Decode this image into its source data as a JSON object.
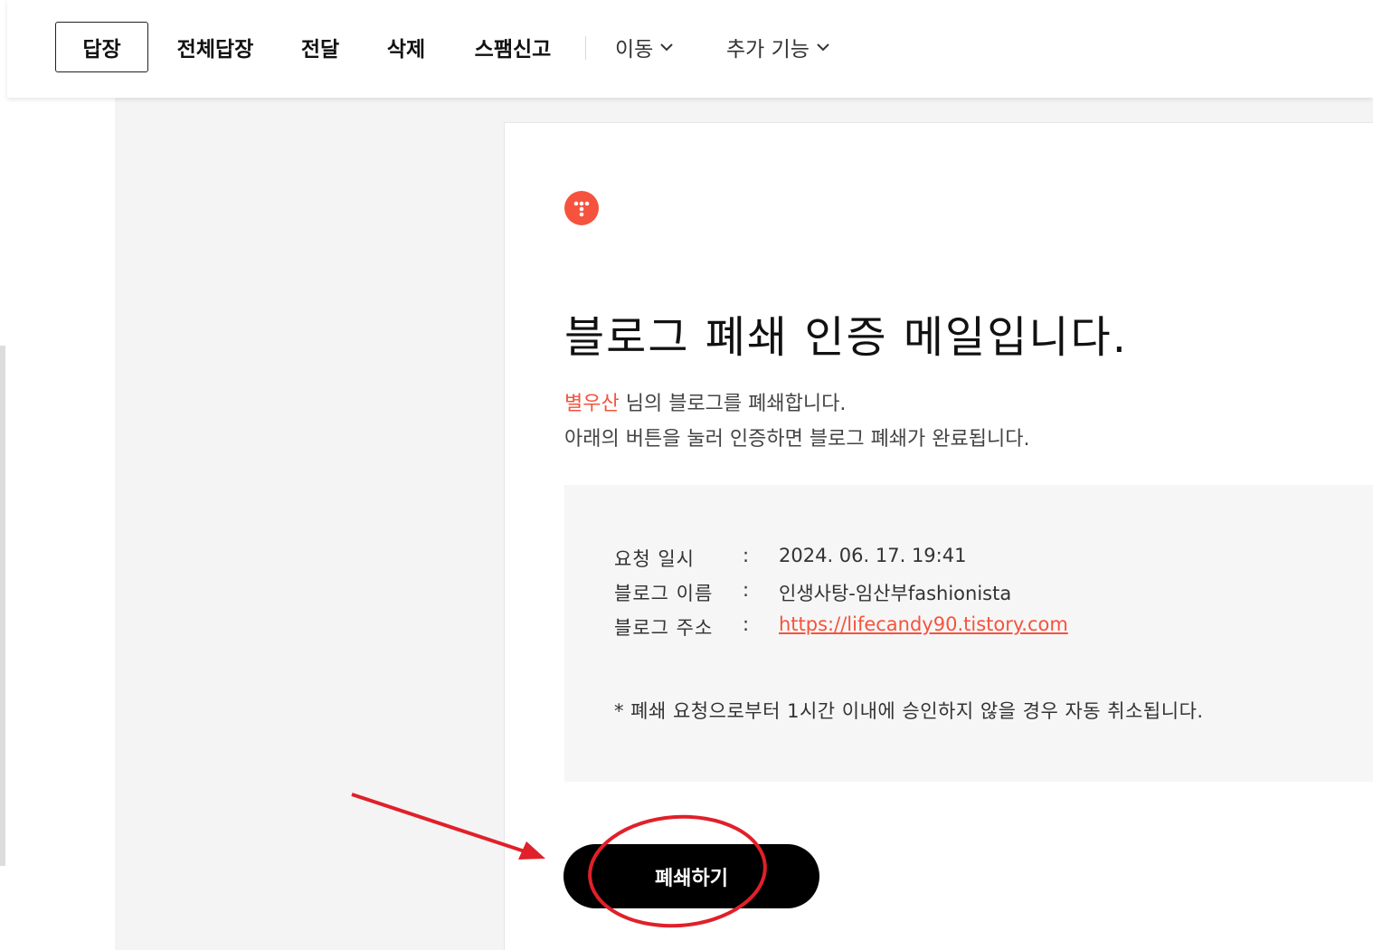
{
  "toolbar": {
    "reply": "답장",
    "reply_all": "전체답장",
    "forward": "전달",
    "delete": "삭제",
    "spam": "스팸신고",
    "move": "이동",
    "more": "추가 기능",
    "chevron_icon": "chevron-down-icon"
  },
  "mail": {
    "logo_icon": "tistory-logo",
    "logo_color": "#f5533d",
    "title": "블로그 폐쇄 인증 메일입니다.",
    "user_name": "별우산",
    "line1_rest": " 님의 블로그를 폐쇄합니다.",
    "line2": "아래의 버튼을 눌러 인증하면 블로그 폐쇄가 완료됩니다.",
    "info": {
      "request_label": "요청 일시",
      "request_value": "2024. 06. 17. 19:41",
      "name_label": "블로그 이름",
      "name_value": "인생사탕-임산부fashionista",
      "url_label": "블로그 주소",
      "url_value": "https://lifecandy90.tistory.com",
      "colon": ":"
    },
    "notice": "* 폐쇄 요청으로부터 1시간 이내에 승인하지 않을 경우 자동 취소됩니다.",
    "close_button": "폐쇄하기"
  },
  "annotation": {
    "color": "#e0202a"
  }
}
